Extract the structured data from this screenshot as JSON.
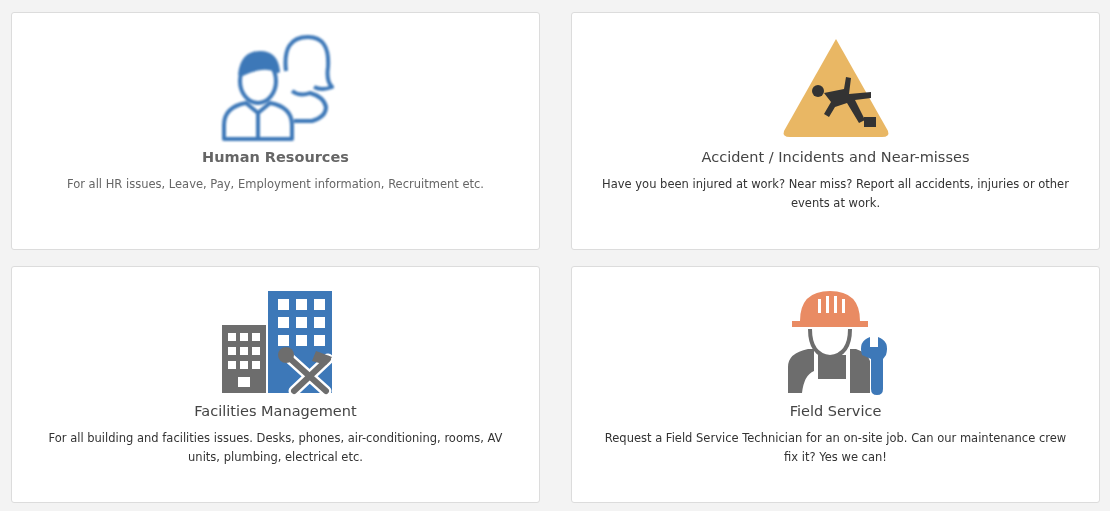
{
  "cards": [
    {
      "kind": "people",
      "title": "Human Resources",
      "description": "For all HR issues, Leave, Pay, Employment information, Recruitment etc.",
      "blurred": true
    },
    {
      "kind": "hazard",
      "title": "Accident / Incidents and Near-misses",
      "description": "Have you been injured at work? Near miss? Report all accidents, injuries or other events at work.",
      "blurred": false
    },
    {
      "kind": "buildings",
      "title": "Facilities Management",
      "description": "For all building and facilities issues. Desks, phones, air-conditioning, rooms, AV units, plumbing, electrical etc.",
      "blurred": false
    },
    {
      "kind": "worker",
      "title": "Field Service",
      "description": "Request a Field Service Technician for an on-site job. Can our maintenance crew fix it? Yes we can!",
      "blurred": false
    }
  ]
}
